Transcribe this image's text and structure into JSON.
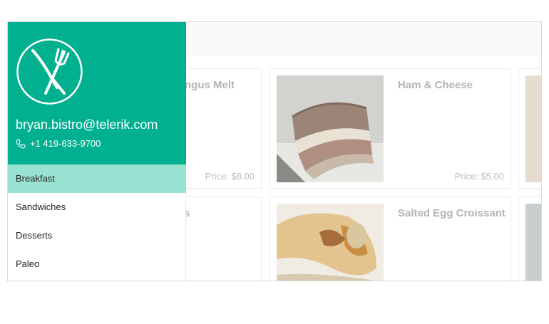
{
  "drawer": {
    "email": "bryan.bistro@telerik.com",
    "phone": "+1 419-633-9700",
    "menu": [
      {
        "label": "Breakfast",
        "selected": true
      },
      {
        "label": "Sandwiches",
        "selected": false
      },
      {
        "label": "Desserts",
        "selected": false
      },
      {
        "label": "Paleo",
        "selected": false
      }
    ],
    "header_color": "#00b08f",
    "selected_color": "#99e2d2",
    "logo_icon": "fork-knife-icon",
    "phone_icon": "phone-icon"
  },
  "items": {
    "angus_melt": {
      "title_partial": "ngus Melt",
      "price": "Price: $8.00"
    },
    "ham_cheese": {
      "title": "Ham & Cheese",
      "price": "Price: $5.00"
    },
    "row2_left": {
      "title_partial": "s"
    },
    "salted_egg": {
      "title": "Salted Egg Croissant"
    }
  }
}
